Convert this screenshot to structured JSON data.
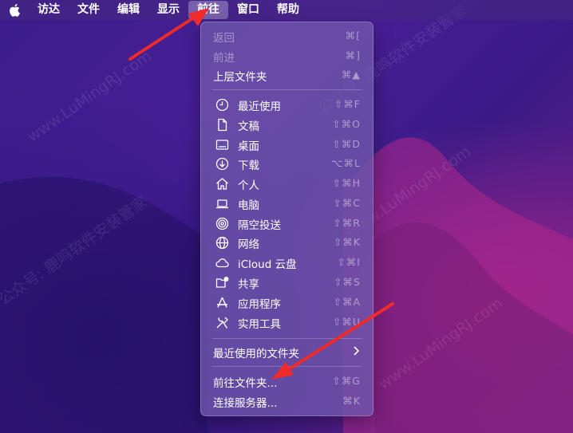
{
  "menubar": {
    "apple_icon": "apple-icon",
    "items": [
      "访达",
      "文件",
      "编辑",
      "显示",
      "前往",
      "窗口",
      "帮助"
    ],
    "active_item": "前往"
  },
  "menu": {
    "nav": [
      {
        "label": "返回",
        "shortcut": "⌘[",
        "enabled": false
      },
      {
        "label": "前进",
        "shortcut": "⌘]",
        "enabled": false
      },
      {
        "label": "上层文件夹",
        "shortcut": "⌘▲",
        "enabled": true
      }
    ],
    "places": [
      {
        "label": "最近使用",
        "shortcut": "⇧⌘F",
        "icon": "clock-icon"
      },
      {
        "label": "文稿",
        "shortcut": "⇧⌘O",
        "icon": "document-icon"
      },
      {
        "label": "桌面",
        "shortcut": "⇧⌘D",
        "icon": "desktop-icon"
      },
      {
        "label": "下载",
        "shortcut": "⌥⌘L",
        "icon": "download-icon"
      },
      {
        "label": "个人",
        "shortcut": "⇧⌘H",
        "icon": "home-icon"
      },
      {
        "label": "电脑",
        "shortcut": "⇧⌘C",
        "icon": "laptop-icon"
      },
      {
        "label": "隔空投送",
        "shortcut": "⇧⌘R",
        "icon": "airdrop-icon"
      },
      {
        "label": "网络",
        "shortcut": "⇧⌘K",
        "icon": "globe-icon"
      },
      {
        "label": "iCloud 云盘",
        "shortcut": "⇧⌘I",
        "icon": "cloud-icon"
      },
      {
        "label": "共享",
        "shortcut": "⇧⌘S",
        "icon": "shared-folder-icon"
      },
      {
        "label": "应用程序",
        "shortcut": "⇧⌘A",
        "icon": "applications-icon"
      },
      {
        "label": "实用工具",
        "shortcut": "⇧⌘U",
        "icon": "utilities-icon"
      }
    ],
    "recent_folders": {
      "label": "最近使用的文件夹",
      "chevron": "chevron-right-icon"
    },
    "goto_folder": {
      "label": "前往文件夹...",
      "shortcut": "⇧⌘G"
    },
    "connect_server": {
      "label": "连接服务器...",
      "shortcut": "⌘K"
    }
  },
  "watermark": [
    "公众号: 鹿鸣软件安装管家",
    "www.LuMingRJ.com"
  ],
  "colors": {
    "menu_bg": "#6e55aa",
    "arrow": "#ee2a2a",
    "menubar_active": "#8a74c0"
  }
}
